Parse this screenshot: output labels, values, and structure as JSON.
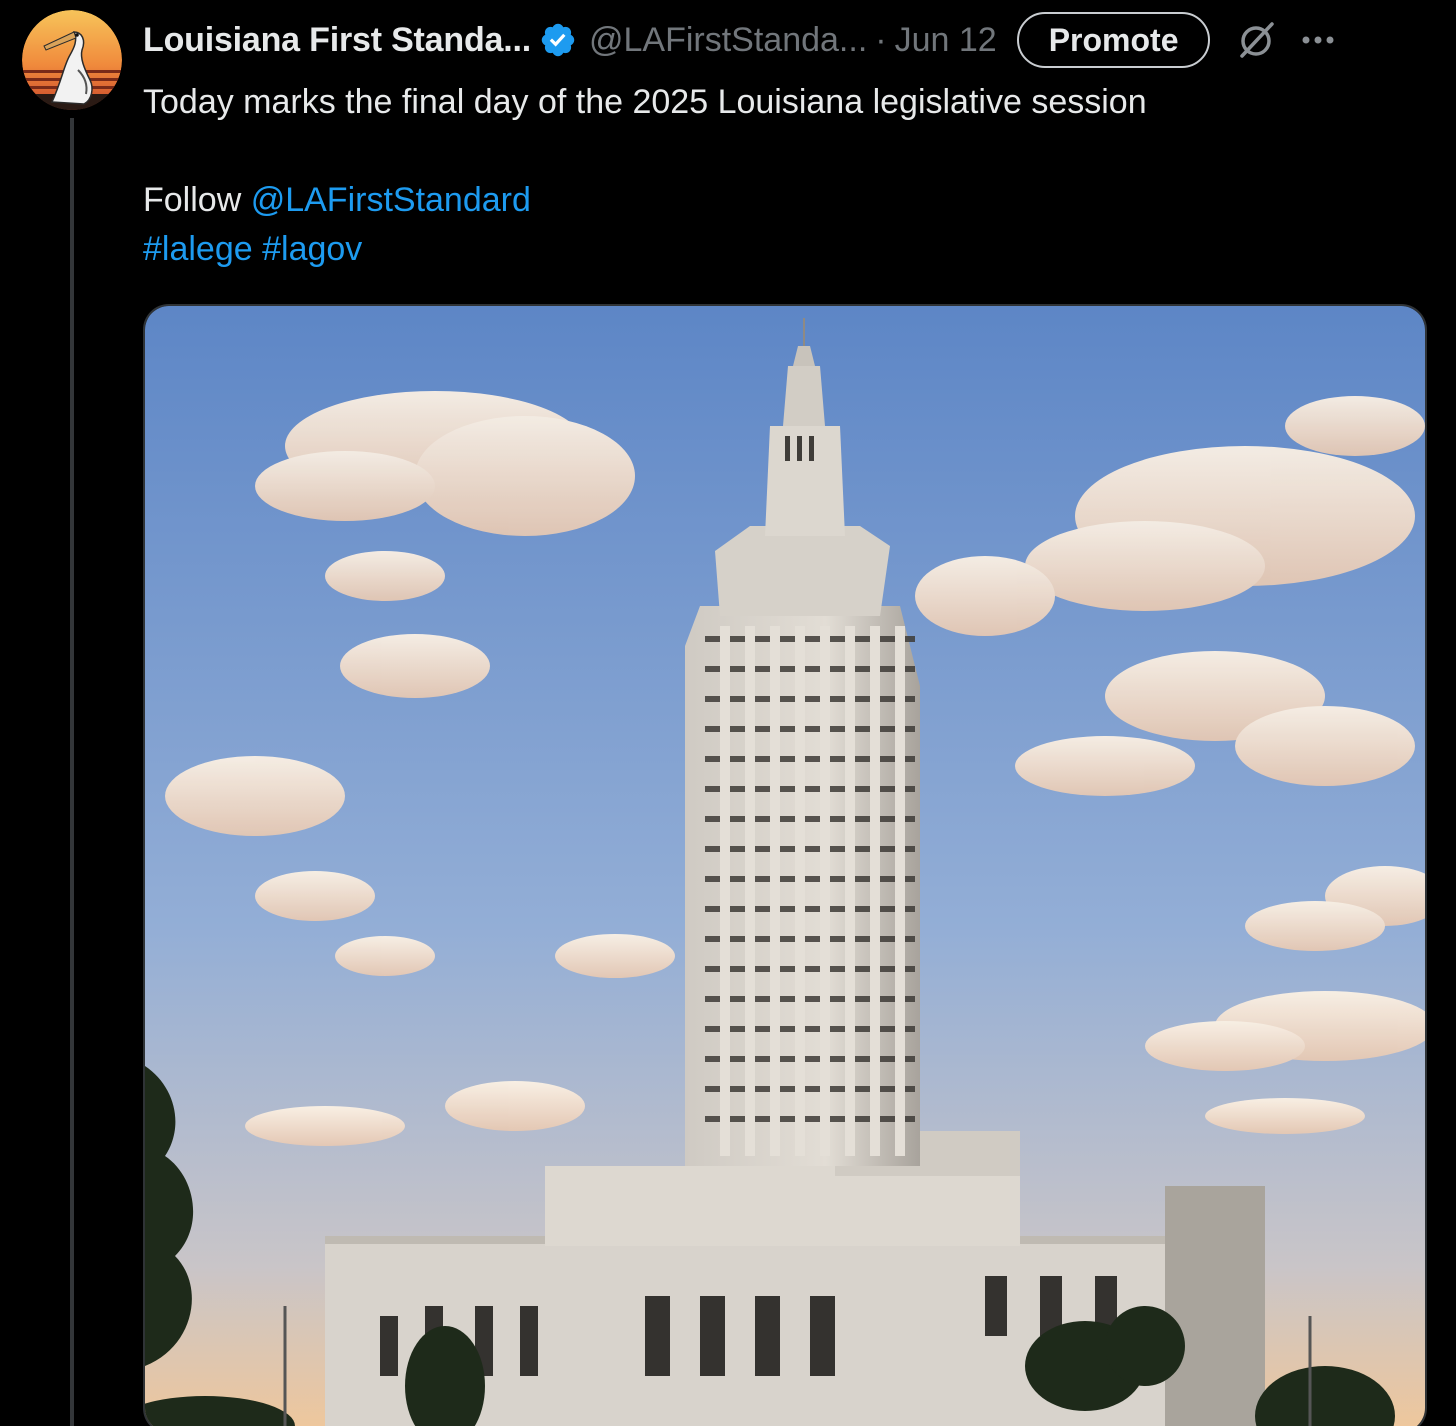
{
  "tweet": {
    "display_name": "Louisiana First Standa...",
    "handle": "@LAFirstStanda...",
    "separator": "·",
    "date": "Jun 12",
    "promote_label": "Promote",
    "text_line1": "Today marks the final day of the 2025 Louisiana legislative session",
    "follow_prefix": "Follow ",
    "follow_mention": "@LAFirstStandard",
    "hashtag1": "#lalege",
    "hashtag2": "#lagov"
  },
  "icons": {
    "verified": "verified-badge-icon",
    "grok": "grok-icon",
    "more": "more-dots-icon"
  },
  "colors": {
    "background": "#000000",
    "text": "#e7e9ea",
    "muted": "#71767b",
    "link": "#1d9bf0",
    "verified": "#1d9bf0"
  }
}
